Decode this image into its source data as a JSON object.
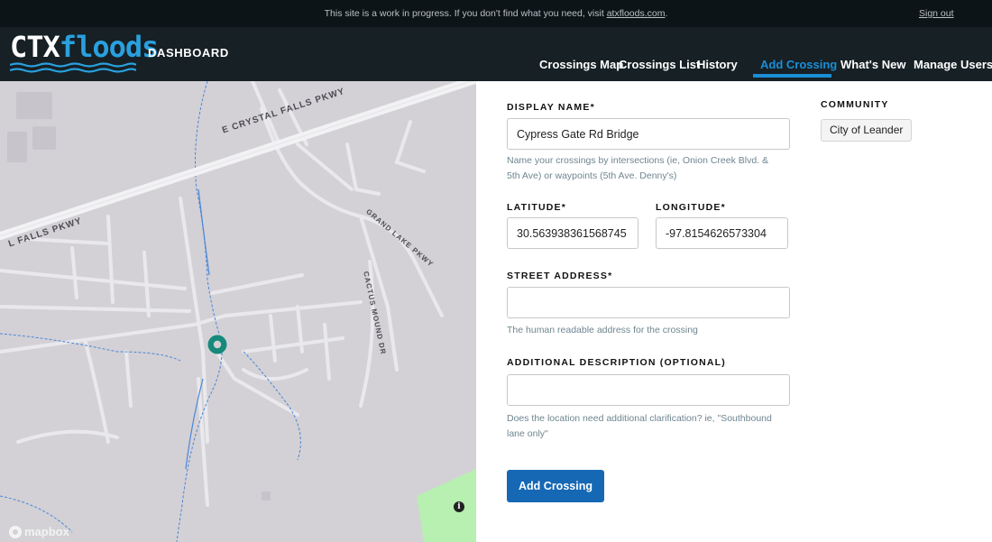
{
  "notice": {
    "message_prefix": "This site is a work in progress. If you don't find what you need, visit ",
    "message_link": "atxfloods.com",
    "message_suffix": ".",
    "signout": "Sign out"
  },
  "brand": {
    "logo_ctx": "CTX",
    "logo_floods": "floods",
    "section": "DASHBOARD"
  },
  "nav": {
    "items": [
      {
        "label": "Crossings Map",
        "active": false
      },
      {
        "label": "Crossings List",
        "active": false
      },
      {
        "label": "History",
        "active": false
      },
      {
        "label": "Add Crossing",
        "active": true
      },
      {
        "label": "What's New",
        "active": false
      },
      {
        "label": "Manage Users",
        "active": false
      }
    ]
  },
  "map": {
    "street_labels": [
      "E CRYSTAL FALLS PKWY",
      "L FALLS PKWY",
      "GRAND LAKE PKWY",
      "CACTUS MOUND DR"
    ],
    "attribution": "mapbox",
    "info_icon": "i",
    "colors": {
      "background": "#d3d1d6",
      "road": "#e9e8ec",
      "water": "#4a86d6",
      "park": "#b7f0b1",
      "marker": "#168a7b"
    }
  },
  "form": {
    "display_name": {
      "label": "DISPLAY NAME*",
      "value": "Cypress Gate Rd Bridge",
      "help": "Name your crossings by intersections (ie, Onion Creek Blvd. & 5th Ave) or waypoints (5th Ave. Denny's)"
    },
    "latitude": {
      "label": "LATITUDE*",
      "value": "30.563938361568745"
    },
    "longitude": {
      "label": "LONGITUDE*",
      "value": "-97.8154626573304"
    },
    "street_address": {
      "label": "STREET ADDRESS*",
      "value": "",
      "help": "The human readable address for the crossing"
    },
    "additional_description": {
      "label": "ADDITIONAL DESCRIPTION (OPTIONAL)",
      "value": "",
      "help": "Does the location need additional clarification? ie, \"Southbound lane only\""
    },
    "community": {
      "label": "COMMUNITY",
      "value": "City of Leander"
    },
    "submit_label": "Add Crossing"
  },
  "colors": {
    "accent": "#1b8ed6",
    "header_bg": "#162025",
    "notice_bg": "#0c1418",
    "button": "#1668b5"
  }
}
